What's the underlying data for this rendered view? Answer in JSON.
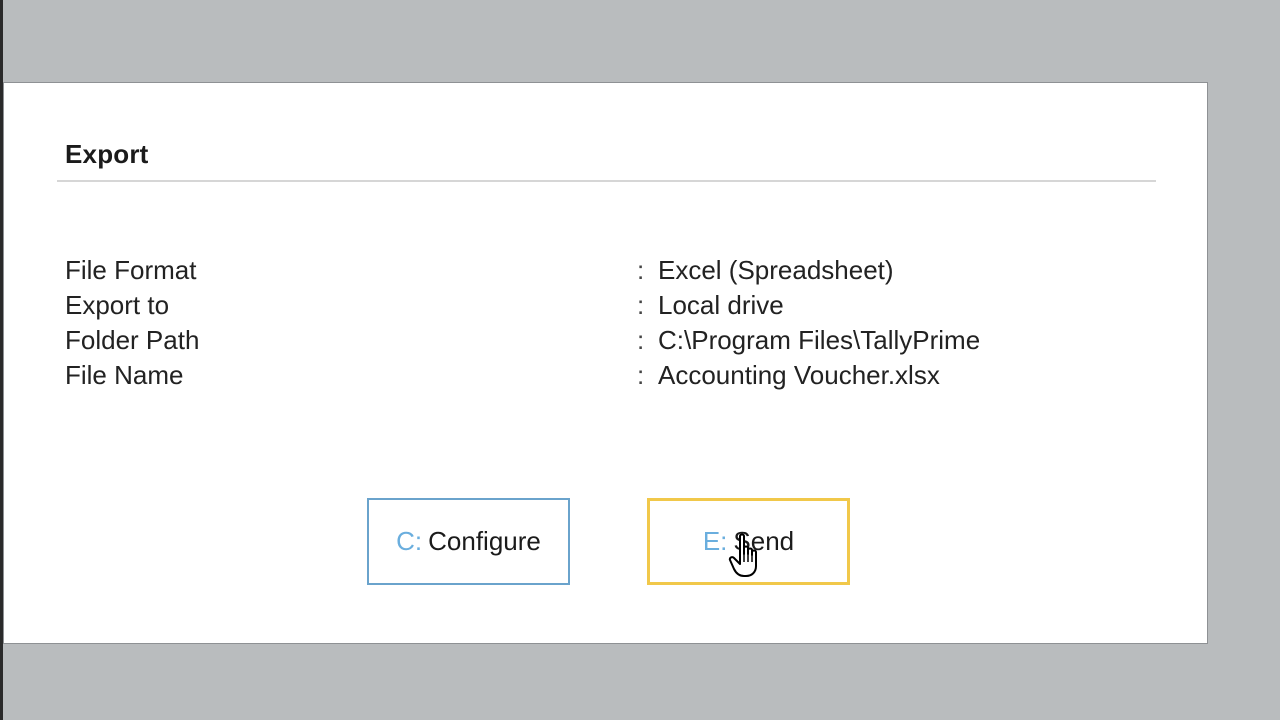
{
  "dialog": {
    "title": "Export"
  },
  "fields": [
    {
      "label": "File Format",
      "colon": ":",
      "value": "Excel (Spreadsheet)"
    },
    {
      "label": "Export to",
      "colon": ":",
      "value": "Local drive"
    },
    {
      "label": "Folder Path",
      "colon": ":",
      "value": "C:\\Program Files\\TallyPrime"
    },
    {
      "label": "File Name",
      "colon": ":",
      "value": "Accounting Voucher.xlsx"
    }
  ],
  "buttons": {
    "configure": {
      "key": "C:",
      "label": "Configure"
    },
    "send": {
      "key": "E:",
      "label": "Send"
    }
  },
  "colors": {
    "background": "#b9bcbe",
    "dialog": "#ffffff",
    "configure_border": "#6aa3cc",
    "send_border": "#f1c84a",
    "shortcut_key": "#6aaede"
  },
  "icons": {
    "cursor": "hand-pointer-icon"
  }
}
